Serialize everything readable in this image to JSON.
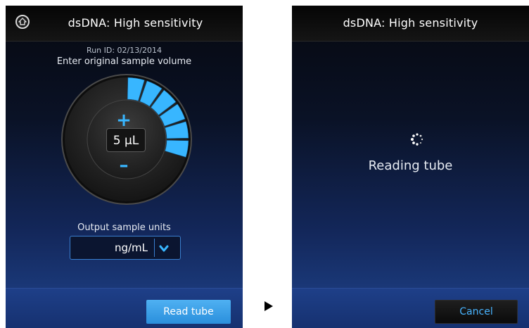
{
  "left_screen": {
    "title": "dsDNA: High sensitivity",
    "run_id": "Run ID: 02/13/2014",
    "instruction": "Enter original sample volume",
    "volume_value": "5 µL",
    "volume_level": 0.3,
    "units_label": "Output sample units",
    "units_selected": "ng/mL",
    "read_button": "Read tube"
  },
  "right_screen": {
    "title": "dsDNA: High sensitivity",
    "status": "Reading tube",
    "cancel_button": "Cancel"
  },
  "icons": {
    "home": "home-icon",
    "plus": "plus-icon",
    "minus": "minus-icon",
    "chevron": "chevron-down-icon",
    "spinner": "spinner-icon",
    "arrow": "arrow-right-icon"
  },
  "colors": {
    "accent": "#38b6ff",
    "button": "#2a8fdc",
    "background": "#13275a"
  }
}
